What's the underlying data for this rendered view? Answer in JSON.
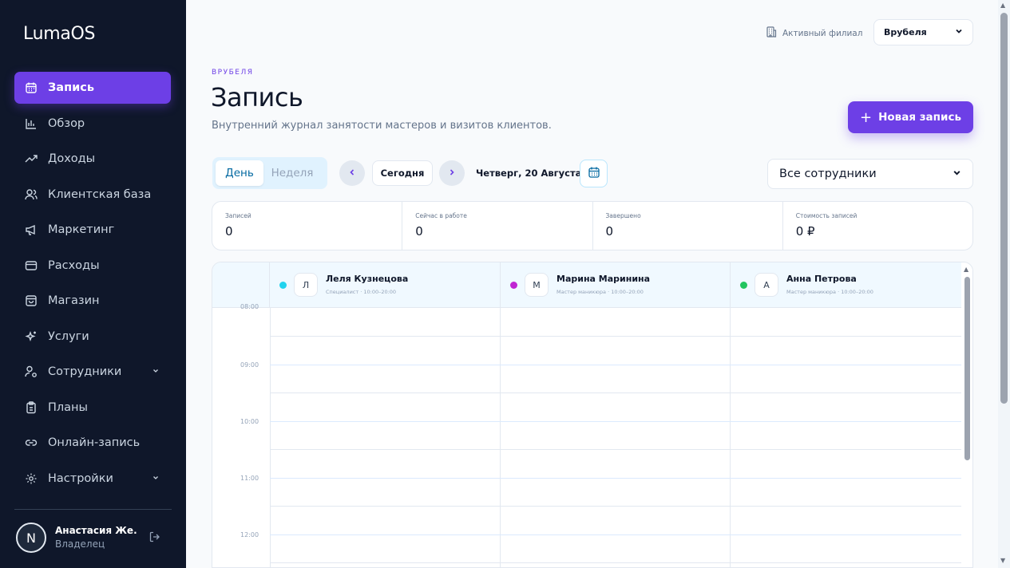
{
  "app": {
    "logo": "LumaOS"
  },
  "sidebar": {
    "items": [
      {
        "label": "Запись",
        "icon": "calendar-icon",
        "active": true
      },
      {
        "label": "Обзор",
        "icon": "bar-chart-icon"
      },
      {
        "label": "Доходы",
        "icon": "trending-up-icon"
      },
      {
        "label": "Клиентская база",
        "icon": "users-icon"
      },
      {
        "label": "Маркетинг",
        "icon": "megaphone-icon"
      },
      {
        "label": "Расходы",
        "icon": "credit-card-icon"
      },
      {
        "label": "Магазин",
        "icon": "shopping-bag-icon"
      },
      {
        "label": "Услуги",
        "icon": "sparkles-icon"
      },
      {
        "label": "Сотрудники",
        "icon": "user-cog-icon",
        "expandable": true
      },
      {
        "label": "Планы",
        "icon": "clipboard-icon"
      },
      {
        "label": "Онлайн-запись",
        "icon": "link-icon"
      },
      {
        "label": "Настройки",
        "icon": "gear-icon",
        "expandable": true
      }
    ],
    "user": {
      "initial": "N",
      "name": "Анастасия Же...",
      "role": "Владелец"
    }
  },
  "header": {
    "branch_label": "Активный филиал",
    "branch_value": "Врубеля",
    "overline": "ВРУБЕЛЯ",
    "title": "Запись",
    "subtitle": "Внутренний журнал занятости мастеров и визитов клиентов.",
    "new_button": "Новая запись"
  },
  "toolbar": {
    "view_day": "День",
    "view_week": "Неделя",
    "today": "Сегодня",
    "date": "Четверг, 20 Августа",
    "staff_filter": "Все сотрудники"
  },
  "stats": [
    {
      "label": "Записей",
      "value": "0"
    },
    {
      "label": "Сейчас в работе",
      "value": "0"
    },
    {
      "label": "Завершено",
      "value": "0"
    },
    {
      "label": "Стоимость записей",
      "value": "0 ₽"
    }
  ],
  "employees": [
    {
      "initial": "Л",
      "name": "Леля Кузнецова",
      "subtitle": "Специалист · 10:00–20:00",
      "color": "#22d3ee"
    },
    {
      "initial": "М",
      "name": "Марина Маринина",
      "subtitle": "Мастер маникюра · 10:00–20:00",
      "color": "#c026d3"
    },
    {
      "initial": "А",
      "name": "Анна Петрова",
      "subtitle": "Мастер маникюра · 10:00–20:00",
      "color": "#22c55e"
    }
  ],
  "times": [
    "08:00",
    "09:00",
    "10:00",
    "11:00",
    "12:00"
  ],
  "colors": {
    "accent": "#6d3fe6",
    "sidebar_bg": "#0f172a"
  }
}
